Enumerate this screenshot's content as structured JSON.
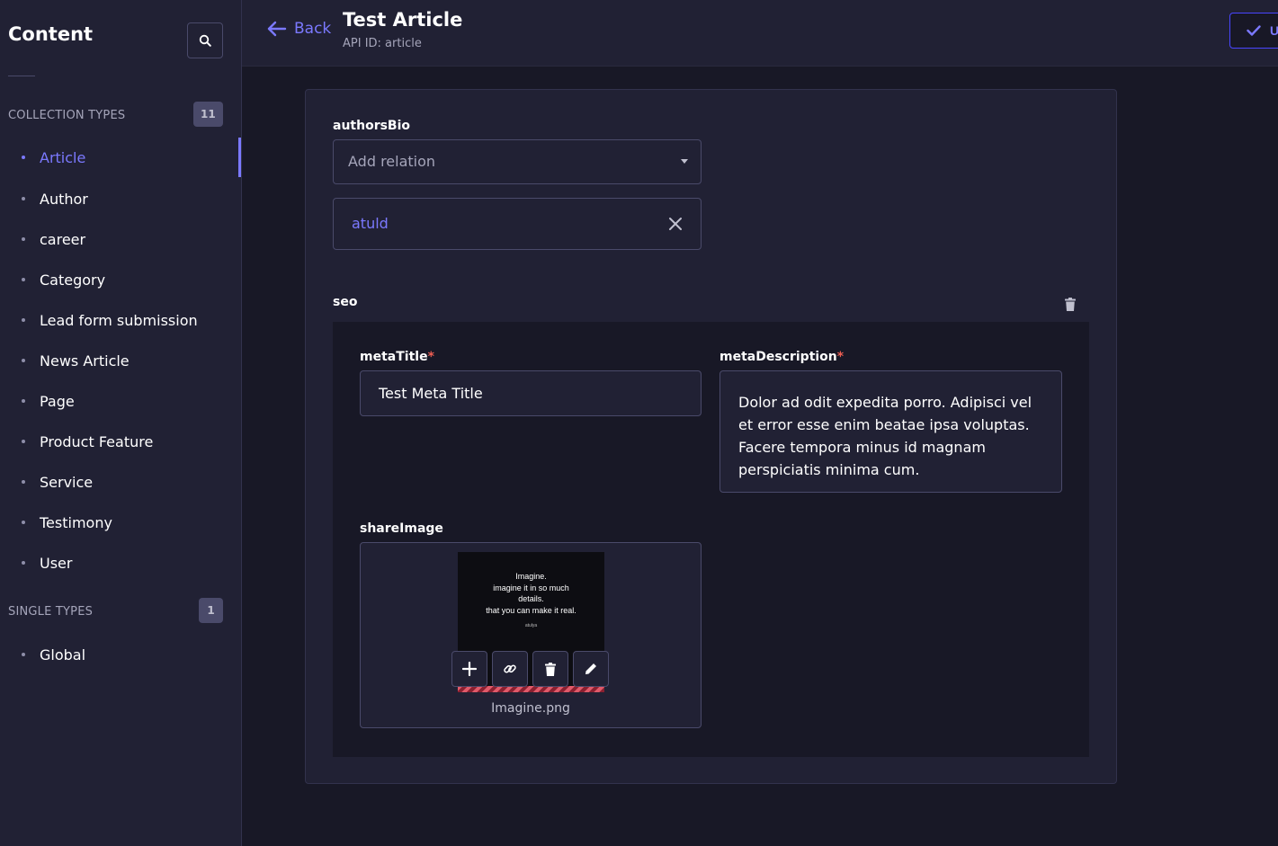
{
  "sidebar": {
    "title": "Content",
    "collection_types": {
      "header": "Collection types",
      "count": "11",
      "items": [
        {
          "label": "Article"
        },
        {
          "label": "Author"
        },
        {
          "label": "career"
        },
        {
          "label": "Category"
        },
        {
          "label": "Lead form submission"
        },
        {
          "label": "News Article"
        },
        {
          "label": "Page"
        },
        {
          "label": "Product Feature"
        },
        {
          "label": "Service"
        },
        {
          "label": "Testimony"
        },
        {
          "label": "User"
        }
      ]
    },
    "single_types": {
      "header": "Single types",
      "count": "1",
      "items": [
        {
          "label": "Global"
        }
      ]
    },
    "active_item": "Article"
  },
  "header": {
    "back_label": "Back",
    "title": "Test Article",
    "api_id": "API ID: article",
    "action_label": "U"
  },
  "form": {
    "authors_bio": {
      "label": "authorsBio",
      "placeholder": "Add relation",
      "relations": [
        "atuld"
      ]
    },
    "seo": {
      "label": "seo",
      "meta_title": {
        "label": "metaTitle",
        "required_mark": "*",
        "value": "Test Meta Title"
      },
      "meta_description": {
        "label": "metaDescription",
        "required_mark": "*",
        "value": "Dolor ad odit expedita porro. Adipisci vel et error esse enim beatae ipsa voluptas. Facere tempora minus id magnam perspiciatis minima cum."
      },
      "share_image": {
        "label": "shareImage",
        "file_name": "Imagine.png",
        "thumbnail_text": [
          "Imagine.",
          "imagine it in so much",
          "details.",
          "that you can make it real.",
          "atulya"
        ]
      }
    }
  },
  "colors": {
    "accent": "#7b79ff",
    "primary": "#4945ff",
    "required": "#ee5e52",
    "sidebar_bg": "#212134",
    "page_bg": "#181826"
  }
}
